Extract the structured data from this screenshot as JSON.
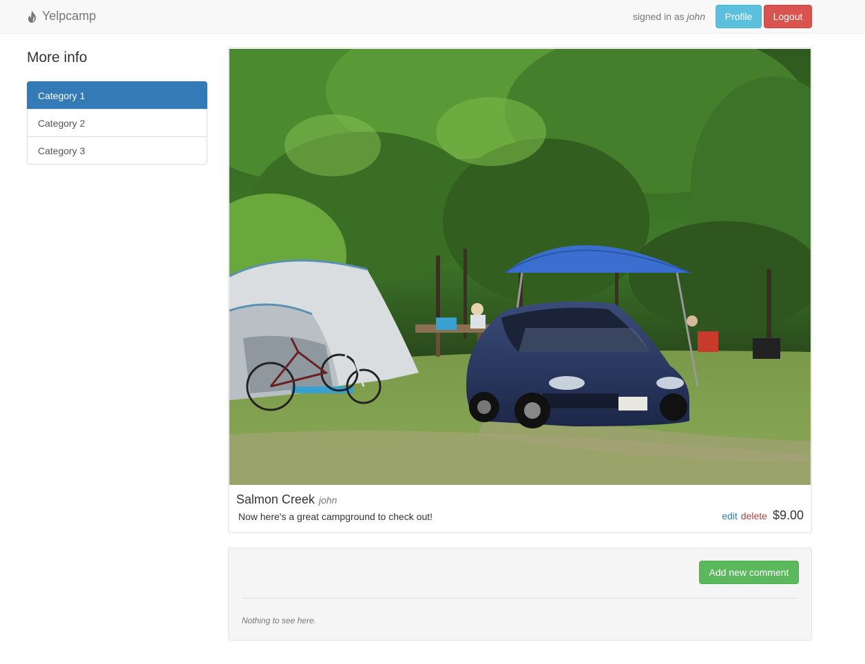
{
  "navbar": {
    "brand": "Yelpcamp",
    "signed_in_prefix": "signed in as",
    "username": "john",
    "profile_label": "Profile",
    "logout_label": "Logout"
  },
  "sidebar": {
    "heading": "More info",
    "items": [
      {
        "label": "Category 1",
        "active": true
      },
      {
        "label": "Category 2",
        "active": false
      },
      {
        "label": "Category 3",
        "active": false
      }
    ]
  },
  "campground": {
    "name": "Salmon Creek",
    "author": "john",
    "description": "Now here's a great campground to check out!",
    "edit_label": "edit",
    "delete_label": "delete",
    "price": "$9.00"
  },
  "comments": {
    "add_label": "Add new comment",
    "empty_text": "Nothing to see here."
  },
  "colors": {
    "accent": "#337ab7",
    "profile": "#5bc0de",
    "logout": "#d9534f",
    "comment": "#5cb85c"
  }
}
